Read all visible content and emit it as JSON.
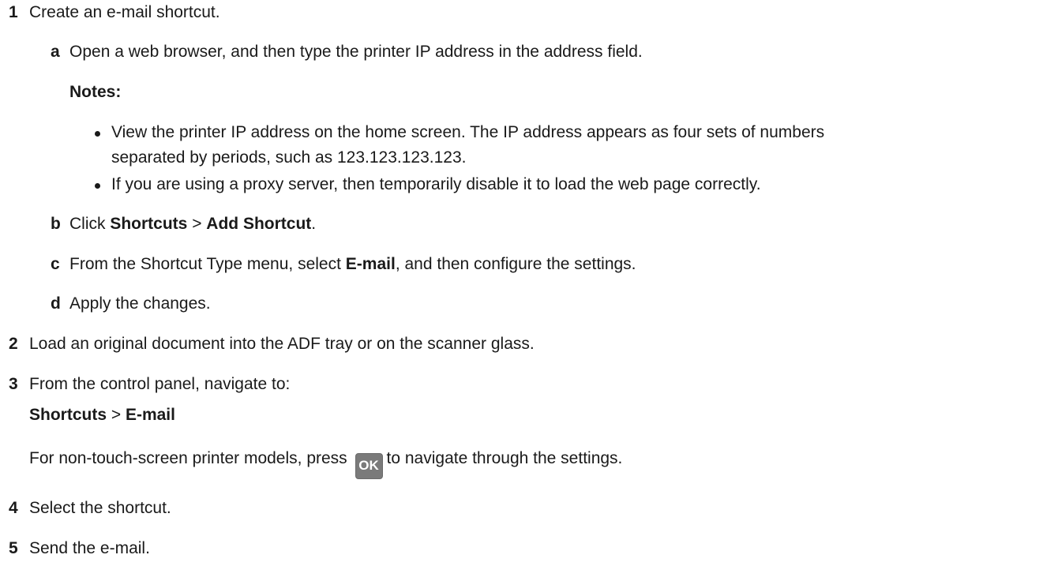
{
  "steps": [
    {
      "number": "1",
      "text": "Create an e-mail shortcut."
    },
    {
      "number": "2",
      "text": "Load an original document into the ADF tray or on the scanner glass."
    },
    {
      "number": "3",
      "text": "From the control panel, navigate to:"
    },
    {
      "number": "4",
      "text": "Select the shortcut."
    },
    {
      "number": "5",
      "text": "Send the e-mail."
    }
  ],
  "substeps": {
    "a": {
      "letter": "a",
      "text": "Open a web browser, and then type the printer IP address in the address field."
    },
    "b": {
      "letter": "b",
      "prefix": "Click ",
      "bold1": "Shortcuts",
      "sep": " > ",
      "bold2": "Add Shortcut",
      "suffix": "."
    },
    "c": {
      "letter": "c",
      "prefix": "From the Shortcut Type menu, select ",
      "bold": "E-mail",
      "suffix": ", and then configure the settings."
    },
    "d": {
      "letter": "d",
      "text": "Apply the changes."
    }
  },
  "notes": {
    "heading": "Notes:",
    "items": [
      {
        "line1": "View the printer IP address on the home screen. The IP address appears as four sets of numbers",
        "line2": "separated by periods, such as 123.123.123.123."
      },
      {
        "line1": "If you are using a proxy server, then temporarily disable it to load the web page correctly."
      }
    ]
  },
  "navigation": {
    "bold1": "Shortcuts",
    "sep": " > ",
    "bold2": "E-mail"
  },
  "non_touch": {
    "prefix": "For non-touch-screen printer models, press ",
    "button_label": "OK",
    "suffix": "to navigate through the settings."
  },
  "icons": {
    "ok_button": "ok-button-icon"
  }
}
